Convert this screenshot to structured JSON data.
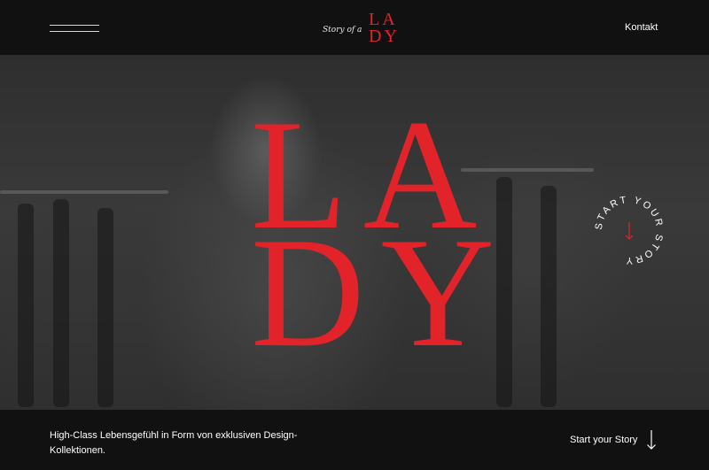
{
  "header": {
    "logo": {
      "script": "Story of a",
      "line1": "LA",
      "line2": "DY"
    },
    "contact_label": "Kontakt"
  },
  "hero": {
    "line1": "LA",
    "line2": "DY",
    "badge_text": "START YOUR STORY"
  },
  "footer": {
    "tagline": "High-Class Lebensgefühl in Form von exklusiven Design-Kollektionen.",
    "cta_label": "Start your Story"
  },
  "icons": {
    "menu": "hamburger-icon",
    "badge_arrow": "arrow-down-icon",
    "cta_arrow": "arrow-down-icon"
  },
  "colors": {
    "accent": "#e2232a",
    "header_bg": "#111111",
    "text": "#ffffff"
  }
}
